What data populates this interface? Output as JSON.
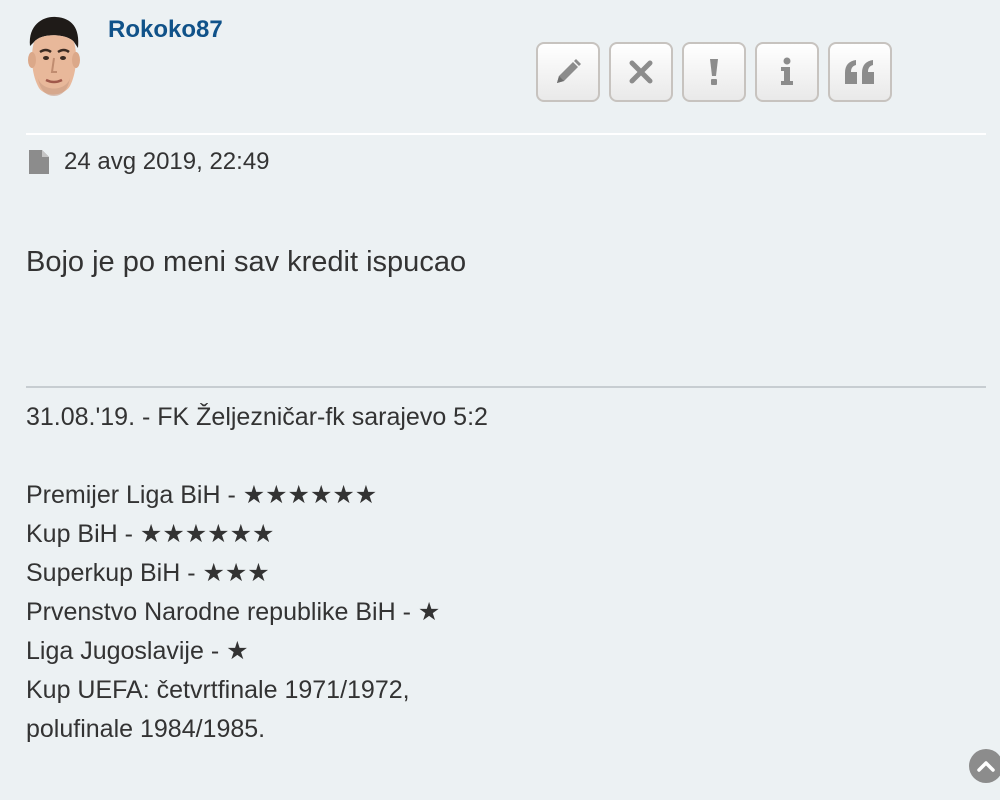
{
  "post": {
    "author": "Rokoko87",
    "date": "24 avg 2019, 22:49",
    "content": "Bojo je po meni sav kredit ispucao"
  },
  "toolbar": {
    "edit_icon": "pencil-icon",
    "delete_icon": "close-icon",
    "report_icon": "exclamation-icon",
    "info_icon": "info-icon",
    "quote_icon": "quote-icon"
  },
  "signature": {
    "lines": [
      "31.08.'19. - FK Željezničar-fk sarajevo 5:2",
      "",
      "Premijer Liga BiH - ★★★★★★",
      "Kup BiH - ★★★★★★",
      "Superkup BiH - ★★★",
      "Prvenstvo Narodne republike BiH - ★",
      "Liga Jugoslavije - ★",
      "Kup UEFA: četvrtfinale 1971/1972,",
      "polufinale 1984/1985."
    ]
  },
  "colors": {
    "background": "#ecf1f3",
    "username": "#105289",
    "text": "#333333"
  }
}
